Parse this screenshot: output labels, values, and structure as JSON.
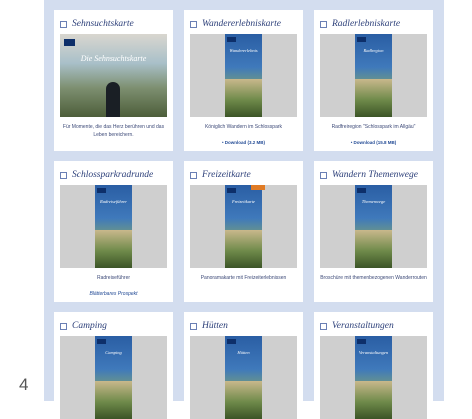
{
  "page_number": "4",
  "colors": {
    "panel": "#d3ddef",
    "title": "#2c3f79",
    "link": "#244c96"
  },
  "cards": [
    {
      "title": "Sehnsuchtskarte",
      "cover_title": "Die Sehnsuchtskarte",
      "desc": "Für Momente, die das Herz berühren und das Leben bereichern.",
      "download": "",
      "link": ""
    },
    {
      "title": "Wandererlebniskarte",
      "cover_title": "Wandererlebnis",
      "desc": "Königlich Wandern im Schlosspark",
      "download": "• Download (3.2 MB)",
      "link": ""
    },
    {
      "title": "Radlerlebniskarte",
      "cover_title": "Radlregion",
      "desc": "Radfreiregion \"Schlosspark im Allgäu\"",
      "download": "• Download (15.8 MB)",
      "link": ""
    },
    {
      "title": "Schlossparkradrunde",
      "cover_title": "Radreiseführer",
      "desc": "Radreiseführer",
      "download": "",
      "link": "Blätterbares Prospekt"
    },
    {
      "title": "Freizeitkarte",
      "cover_title": "Freizeitkarte",
      "desc": "Panoramakarte mit Freizeiterlebnissen",
      "download": "",
      "link": ""
    },
    {
      "title": "Wandern Themenwege",
      "cover_title": "Themenwege",
      "desc": "Broschüre mit themenbezogenen Wanderrouten",
      "download": "",
      "link": ""
    },
    {
      "title": "Camping",
      "cover_title": "Camping",
      "desc": "",
      "download": "",
      "link": ""
    },
    {
      "title": "Hütten",
      "cover_title": "Hütten",
      "desc": "",
      "download": "",
      "link": ""
    },
    {
      "title": "Veranstaltungen",
      "cover_title": "Veranstaltungen",
      "desc": "",
      "download": "",
      "link": ""
    }
  ]
}
